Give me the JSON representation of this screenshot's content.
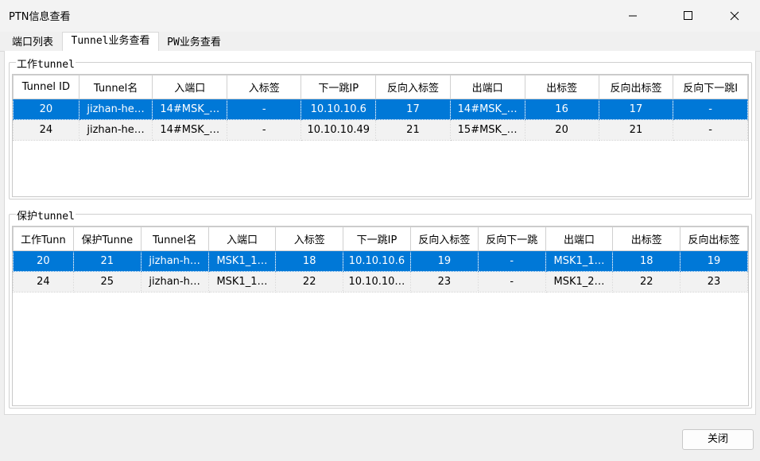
{
  "window": {
    "title": "PTN信息查看"
  },
  "tabs": [
    {
      "label": "端口列表"
    },
    {
      "label": "Tunnel业务查看"
    },
    {
      "label": "PW业务查看"
    }
  ],
  "work_group": {
    "title": "工作tunnel",
    "columns": [
      "Tunnel ID",
      "Tunnel名",
      "入端口",
      "入标签",
      "下一跳IP",
      "反向入标签",
      "出端口",
      "出标签",
      "反向出标签",
      "反向下一跳I"
    ],
    "rows": [
      [
        "20",
        "jizhan-he…",
        "14#MSK_…",
        "-",
        "10.10.10.6",
        "17",
        "14#MSK_…",
        "16",
        "17",
        "-"
      ],
      [
        "24",
        "jizhan-he…",
        "14#MSK_…",
        "-",
        "10.10.10.49",
        "21",
        "15#MSK_…",
        "20",
        "21",
        "-"
      ]
    ]
  },
  "protect_group": {
    "title": "保护tunnel",
    "columns": [
      "工作Tunn",
      "保护Tunne",
      "Tunnel名",
      "入端口",
      "入标签",
      "下一跳IP",
      "反向入标签",
      "反向下一跳",
      "出端口",
      "出标签",
      "反向出标签"
    ],
    "rows": [
      [
        "20",
        "21",
        "jizhan-h…",
        "MSK1_1…",
        "18",
        "10.10.10.6",
        "19",
        "-",
        "MSK1_1…",
        "18",
        "19"
      ],
      [
        "24",
        "25",
        "jizhan-h…",
        "MSK1_1…",
        "22",
        "10.10.10…",
        "23",
        "-",
        "MSK1_2…",
        "22",
        "23"
      ]
    ]
  },
  "footer": {
    "close_label": "关闭"
  },
  "colors": {
    "selection": "#0078d7",
    "alt_row": "#f2f2f2"
  },
  "icons": {
    "minimize": "minimize-icon",
    "maximize": "maximize-icon",
    "close": "close-icon"
  }
}
